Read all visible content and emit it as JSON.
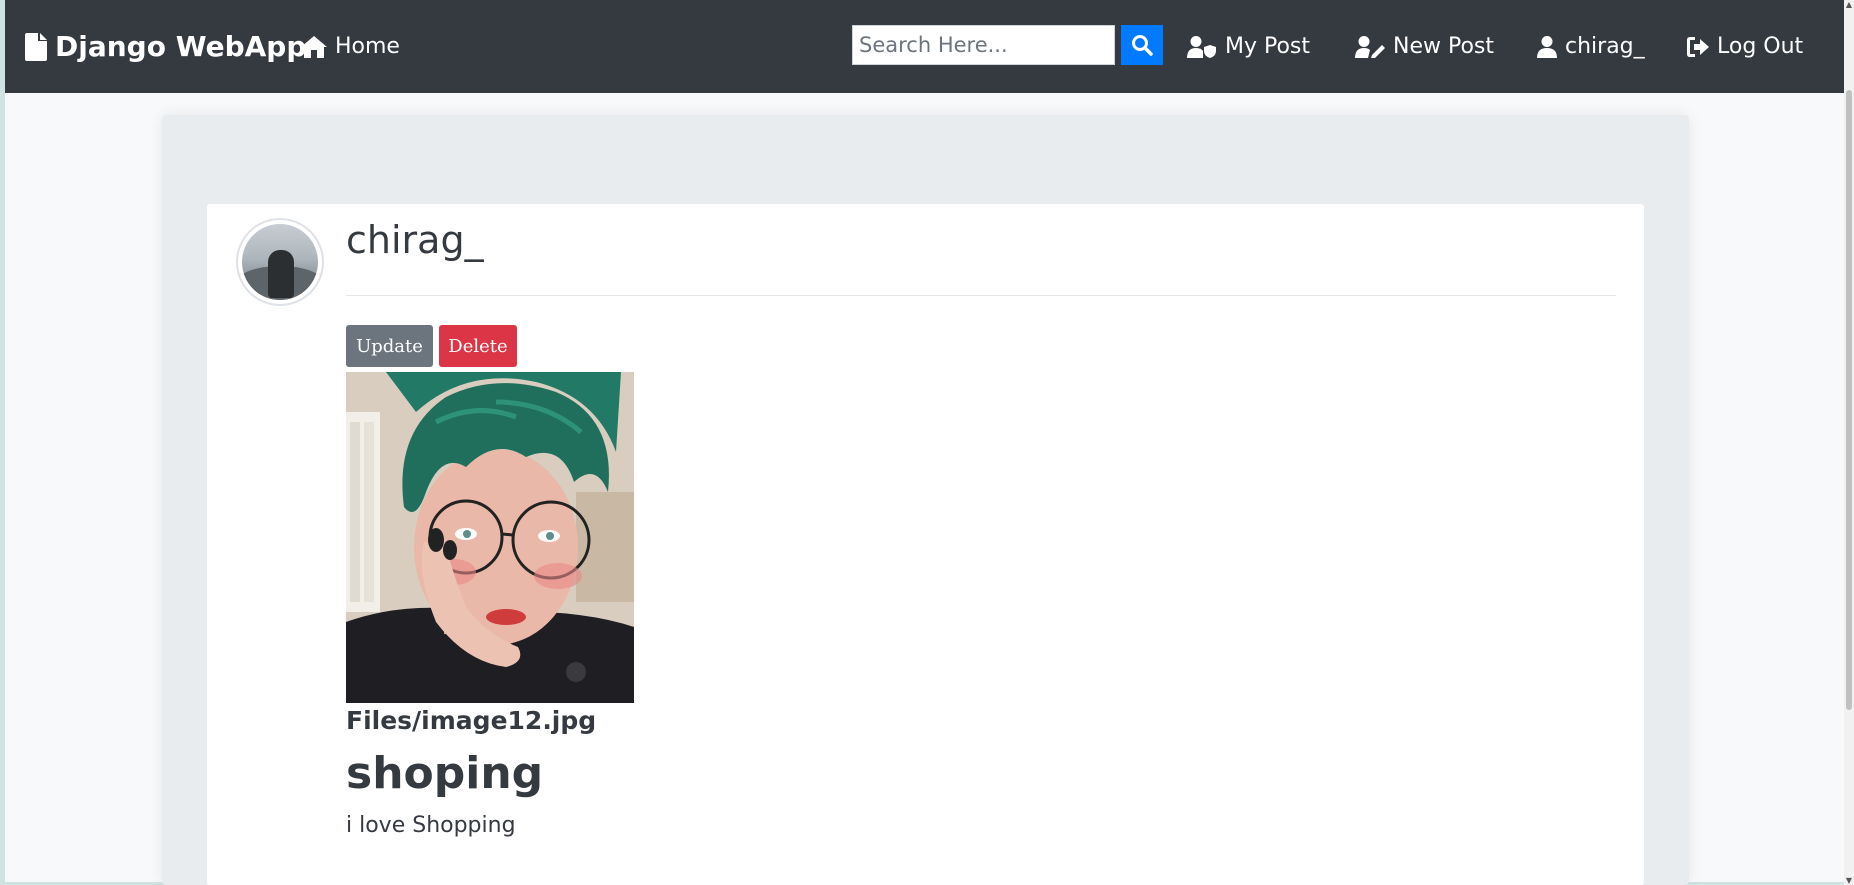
{
  "navbar": {
    "brand": "Django WebApp",
    "home": "Home",
    "search_placeholder": "Search Here...",
    "my_post": "My Post",
    "new_post": "New Post",
    "user": "chirag_",
    "logout": "Log Out"
  },
  "post": {
    "author": "chirag_",
    "update_label": "Update",
    "delete_label": "Delete",
    "image_filename": "Files/image12.jpg",
    "title": "shoping",
    "content": "i love Shopping"
  },
  "colors": {
    "navbar": "#343a40",
    "search_button": "#007bff",
    "update_button": "#6c757d",
    "delete_button": "#dc3545"
  }
}
